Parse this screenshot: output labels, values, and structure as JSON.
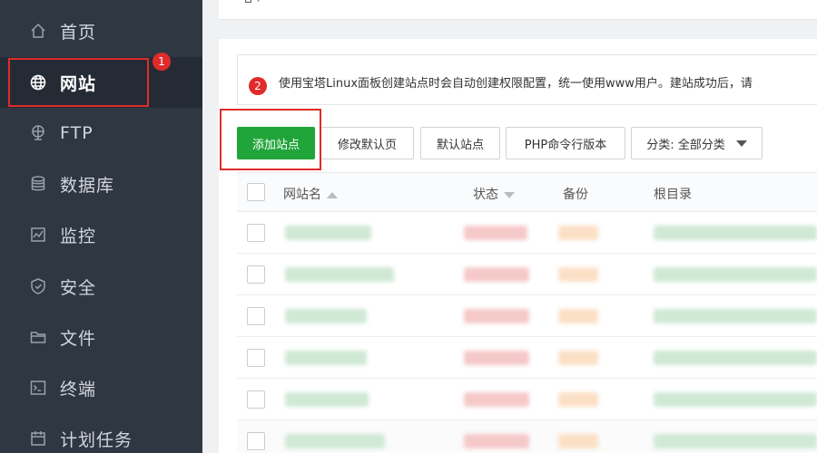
{
  "sidebar": {
    "items": [
      {
        "label": "首页",
        "icon": "home-icon"
      },
      {
        "label": "网站",
        "icon": "globe-icon",
        "active": true
      },
      {
        "label": "FTP",
        "icon": "ftp-icon"
      },
      {
        "label": "数据库",
        "icon": "database-icon"
      },
      {
        "label": "监控",
        "icon": "monitor-icon"
      },
      {
        "label": "安全",
        "icon": "shield-icon"
      },
      {
        "label": "文件",
        "icon": "folder-icon"
      },
      {
        "label": "终端",
        "icon": "terminal-icon"
      },
      {
        "label": "计划任务",
        "icon": "calendar-icon"
      }
    ]
  },
  "callouts": {
    "one": "1",
    "two": "2"
  },
  "notice": {
    "text": "使用宝塔Linux面板创建站点时会自动创建权限配置，统一使用www用户。建站成功后，请"
  },
  "toolbar": {
    "add_site": "添加站点",
    "modify_default_page": "修改默认页",
    "default_site": "默认站点",
    "php_cli_version": "PHP命令行版本",
    "category_select": "分类: 全部分类"
  },
  "table": {
    "headers": {
      "name": "网站名",
      "status": "状态",
      "backup": "备份",
      "root": "根目录"
    },
    "row_count": 6
  },
  "colors": {
    "sidebar_bg": "#2f3743",
    "active_bg": "#242b35",
    "primary_green": "#20a53a",
    "callout_red": "#e02b2b"
  }
}
